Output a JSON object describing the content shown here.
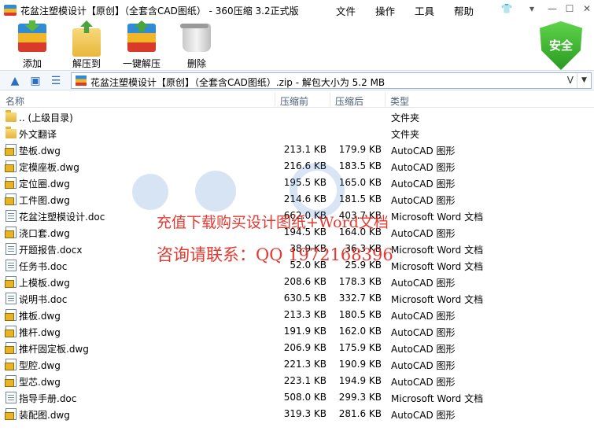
{
  "window": {
    "title": "花盆注塑模设计【原创】（全套含CAD图纸） - 360压缩 3.2正式版",
    "menu": [
      "文件",
      "操作",
      "工具",
      "帮助"
    ]
  },
  "toolbar": {
    "add": "添加",
    "extract": "解压到",
    "one_click": "一键解压",
    "delete": "删除",
    "safe_badge": "安全"
  },
  "address": {
    "path": "花盆注塑模设计【原创】（全套含CAD图纸）.zip - 解包大小为 5.2 MB",
    "v": "V"
  },
  "columns": {
    "name": "名称",
    "compressed": "压缩前",
    "uncompressed": "压缩后",
    "type": "类型"
  },
  "files": [
    {
      "icon": "folder",
      "name": ".. (上级目录)",
      "before": "",
      "after": "",
      "type": "文件夹"
    },
    {
      "icon": "folder",
      "name": "外文翻译",
      "before": "",
      "after": "",
      "type": "文件夹"
    },
    {
      "icon": "dwg",
      "name": "垫板.dwg",
      "before": "213.1 KB",
      "after": "179.9 KB",
      "type": "AutoCAD 图形"
    },
    {
      "icon": "dwg",
      "name": "定模座板.dwg",
      "before": "216.6 KB",
      "after": "183.5 KB",
      "type": "AutoCAD 图形"
    },
    {
      "icon": "dwg",
      "name": "定位圈.dwg",
      "before": "195.5 KB",
      "after": "165.0 KB",
      "type": "AutoCAD 图形"
    },
    {
      "icon": "dwg",
      "name": "工件图.dwg",
      "before": "214.6 KB",
      "after": "181.5 KB",
      "type": "AutoCAD 图形"
    },
    {
      "icon": "doc",
      "name": "花盆注塑模设计.doc",
      "before": "662.0 KB",
      "after": "403.7 KB",
      "type": "Microsoft Word 文档"
    },
    {
      "icon": "dwg",
      "name": "浇口套.dwg",
      "before": "194.5 KB",
      "after": "164.0 KB",
      "type": "AutoCAD 图形"
    },
    {
      "icon": "doc",
      "name": "开题报告.docx",
      "before": "38.9 KB",
      "after": "36.3 KB",
      "type": "Microsoft Word 文档"
    },
    {
      "icon": "doc",
      "name": "任务书.doc",
      "before": "52.0 KB",
      "after": "25.9 KB",
      "type": "Microsoft Word 文档"
    },
    {
      "icon": "dwg",
      "name": "上模板.dwg",
      "before": "208.6 KB",
      "after": "178.3 KB",
      "type": "AutoCAD 图形"
    },
    {
      "icon": "doc",
      "name": "说明书.doc",
      "before": "630.5 KB",
      "after": "332.7 KB",
      "type": "Microsoft Word 文档"
    },
    {
      "icon": "dwg",
      "name": "推板.dwg",
      "before": "213.3 KB",
      "after": "180.5 KB",
      "type": "AutoCAD 图形"
    },
    {
      "icon": "dwg",
      "name": "推杆.dwg",
      "before": "191.9 KB",
      "after": "162.0 KB",
      "type": "AutoCAD 图形"
    },
    {
      "icon": "dwg",
      "name": "推杆固定板.dwg",
      "before": "206.9 KB",
      "after": "175.9 KB",
      "type": "AutoCAD 图形"
    },
    {
      "icon": "dwg",
      "name": "型腔.dwg",
      "before": "221.3 KB",
      "after": "190.9 KB",
      "type": "AutoCAD 图形"
    },
    {
      "icon": "dwg",
      "name": "型芯.dwg",
      "before": "223.1 KB",
      "after": "194.9 KB",
      "type": "AutoCAD 图形"
    },
    {
      "icon": "doc",
      "name": "指导手册.doc",
      "before": "508.0 KB",
      "after": "299.3 KB",
      "type": "Microsoft Word 文档"
    },
    {
      "icon": "dwg",
      "name": "装配图.dwg",
      "before": "319.3 KB",
      "after": "281.6 KB",
      "type": "AutoCAD 图形"
    }
  ],
  "watermark": {
    "line1": "充值下载购买设计图纸+Word文档",
    "line2": "咨询请联系：QQ 1972168396"
  }
}
